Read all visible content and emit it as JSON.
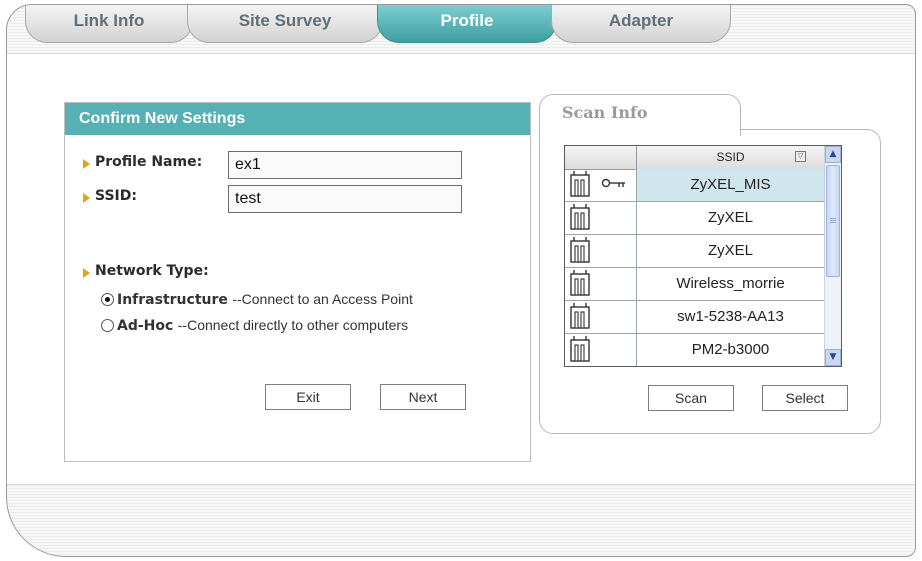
{
  "tabs": [
    {
      "label": "Link Info",
      "active": false
    },
    {
      "label": "Site Survey",
      "active": false
    },
    {
      "label": "Profile",
      "active": true
    },
    {
      "label": "Adapter",
      "active": false
    }
  ],
  "confirm": {
    "title": "Confirm New Settings",
    "profile_name_label": "Profile Name:",
    "profile_name_value": "ex1",
    "ssid_label": "SSID:",
    "ssid_value": "test",
    "network_type_label": "Network Type:",
    "infrastructure_label": "Infrastructure",
    "infrastructure_desc": "--Connect to an Access Point",
    "adhoc_label": "Ad-Hoc",
    "adhoc_desc": "--Connect directly to other computers",
    "selected_network_type": "Infrastructure",
    "exit_label": "Exit",
    "next_label": "Next"
  },
  "scan": {
    "tab_label": "Scan Info",
    "column_header": "SSID",
    "rows": [
      {
        "ssid": "ZyXEL_MIS",
        "secured": true,
        "selected": true
      },
      {
        "ssid": "ZyXEL",
        "secured": false,
        "selected": false
      },
      {
        "ssid": "ZyXEL",
        "secured": false,
        "selected": false
      },
      {
        "ssid": "Wireless_morrie",
        "secured": false,
        "selected": false
      },
      {
        "ssid": "sw1-5238-AA13",
        "secured": false,
        "selected": false
      },
      {
        "ssid": "PM2-b3000",
        "secured": false,
        "selected": false
      }
    ],
    "scan_label": "Scan",
    "select_label": "Select"
  },
  "colors": {
    "accent": "#56b1b4",
    "tab_active": "#4aa9ad",
    "arrow": "#e0a31e",
    "row_selected": "#cfe6ec"
  }
}
